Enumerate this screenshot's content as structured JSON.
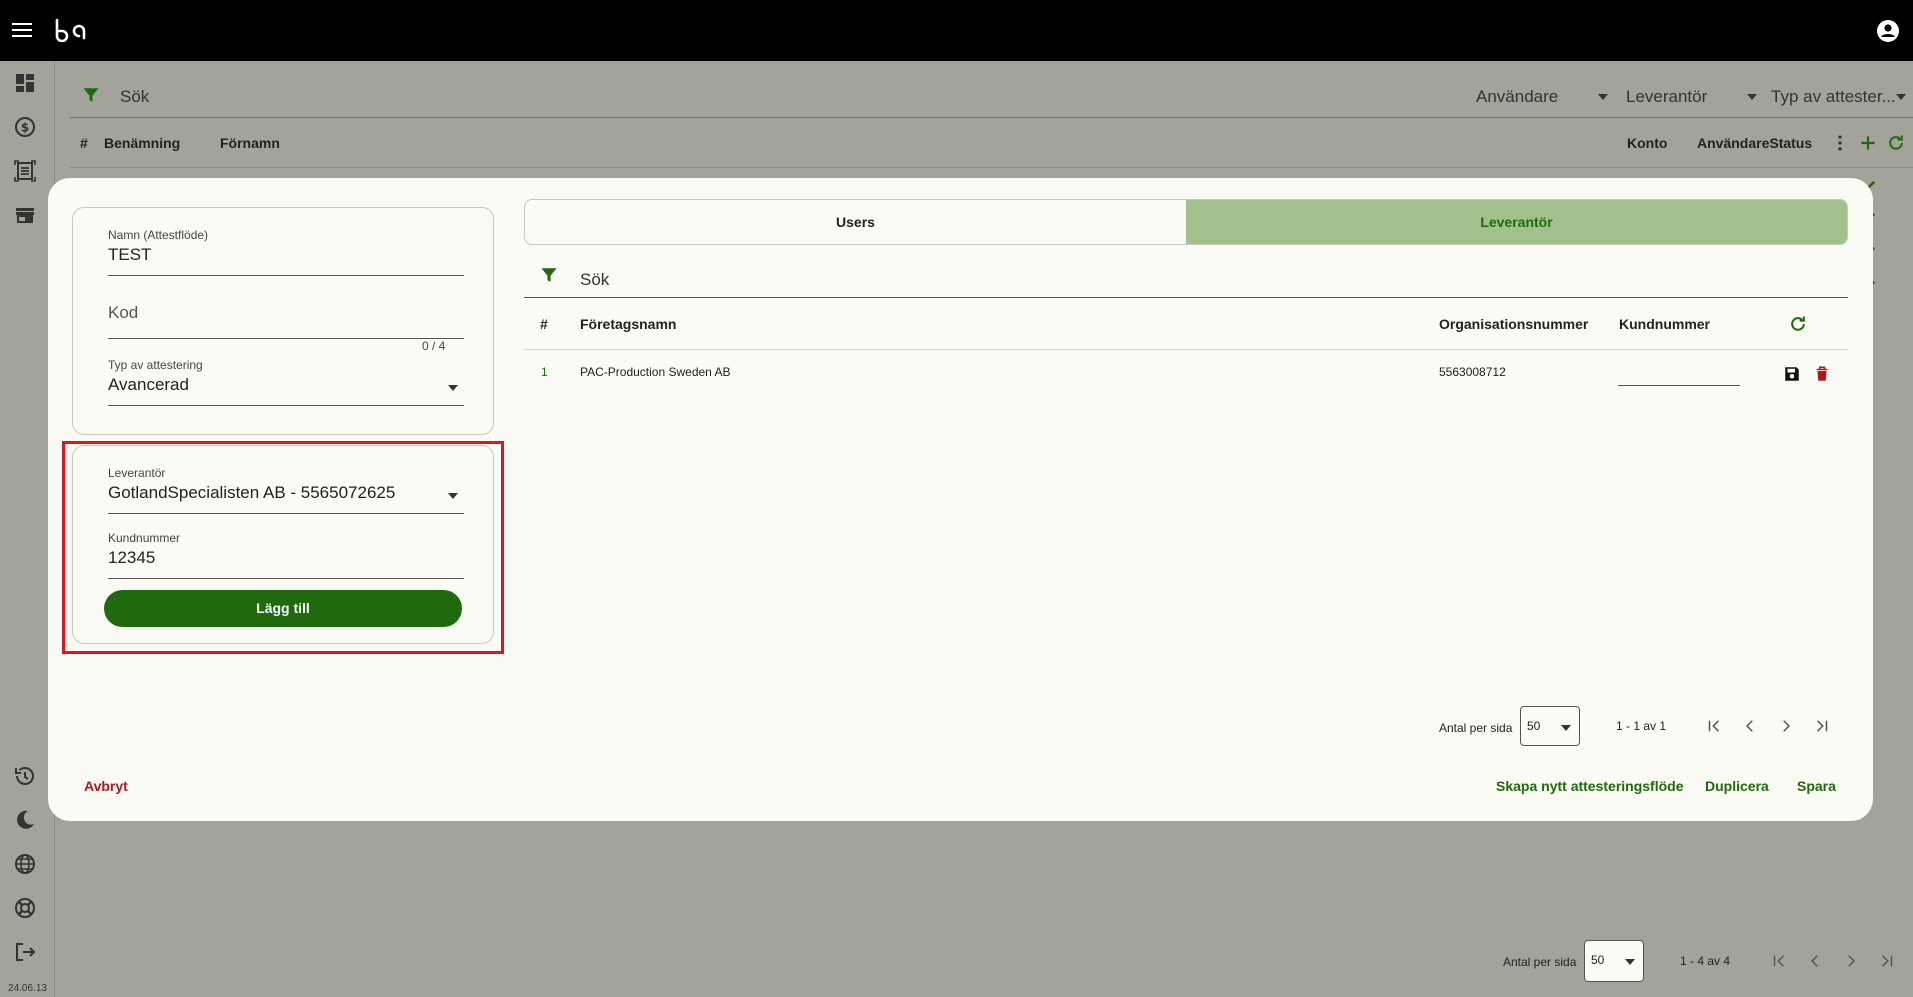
{
  "colors": {
    "brand_green": "#1e6a0c",
    "tab_active_bg": "#a3c18c",
    "danger": "#b3161c",
    "highlight": "#e0161e"
  },
  "rail": {
    "version": "24.06.13"
  },
  "background": {
    "filter": {
      "placeholder": "Sök",
      "dropdowns": [
        "Användare",
        "Leverantör",
        "Typ av attester..."
      ]
    },
    "columns": {
      "hash": "#",
      "benamning": "Benämning",
      "fornamn": "Förnamn",
      "konto": "Konto",
      "status": "AnvändareStatus"
    },
    "pager": {
      "label": "Antal per sida",
      "page_size": "50",
      "range": "1 - 4 av 4"
    }
  },
  "modal": {
    "form": {
      "name_label": "Namn (Attestflöde)",
      "name_value": "TEST",
      "code_placeholder": "Kod",
      "code_counter": "0 / 4",
      "type_label": "Typ av attestering",
      "type_value": "Avancerad"
    },
    "supplier_form": {
      "supplier_label": "Leverantör",
      "supplier_value": "GotlandSpecialisten AB - 5565072625",
      "customer_label": "Kundnummer",
      "customer_value": "12345",
      "add_button": "Lägg till"
    },
    "tabs": [
      {
        "label": "Users",
        "active": false
      },
      {
        "label": "Leverantör",
        "active": true
      }
    ],
    "filter": {
      "placeholder": "Sök"
    },
    "table": {
      "headers": {
        "hash": "#",
        "company": "Företagsnamn",
        "org": "Organisationsnummer",
        "customer": "Kundnummer"
      },
      "rows": [
        {
          "index": "1",
          "company": "PAC-Production Sweden AB",
          "org": "5563008712",
          "customer": ""
        }
      ]
    },
    "pager": {
      "label": "Antal per sida",
      "page_size": "50",
      "range": "1 - 1 av 1"
    },
    "footer": {
      "cancel": "Avbryt",
      "create_new": "Skapa nytt attesteringsflöde",
      "duplicate": "Duplicera",
      "save": "Spara"
    }
  }
}
